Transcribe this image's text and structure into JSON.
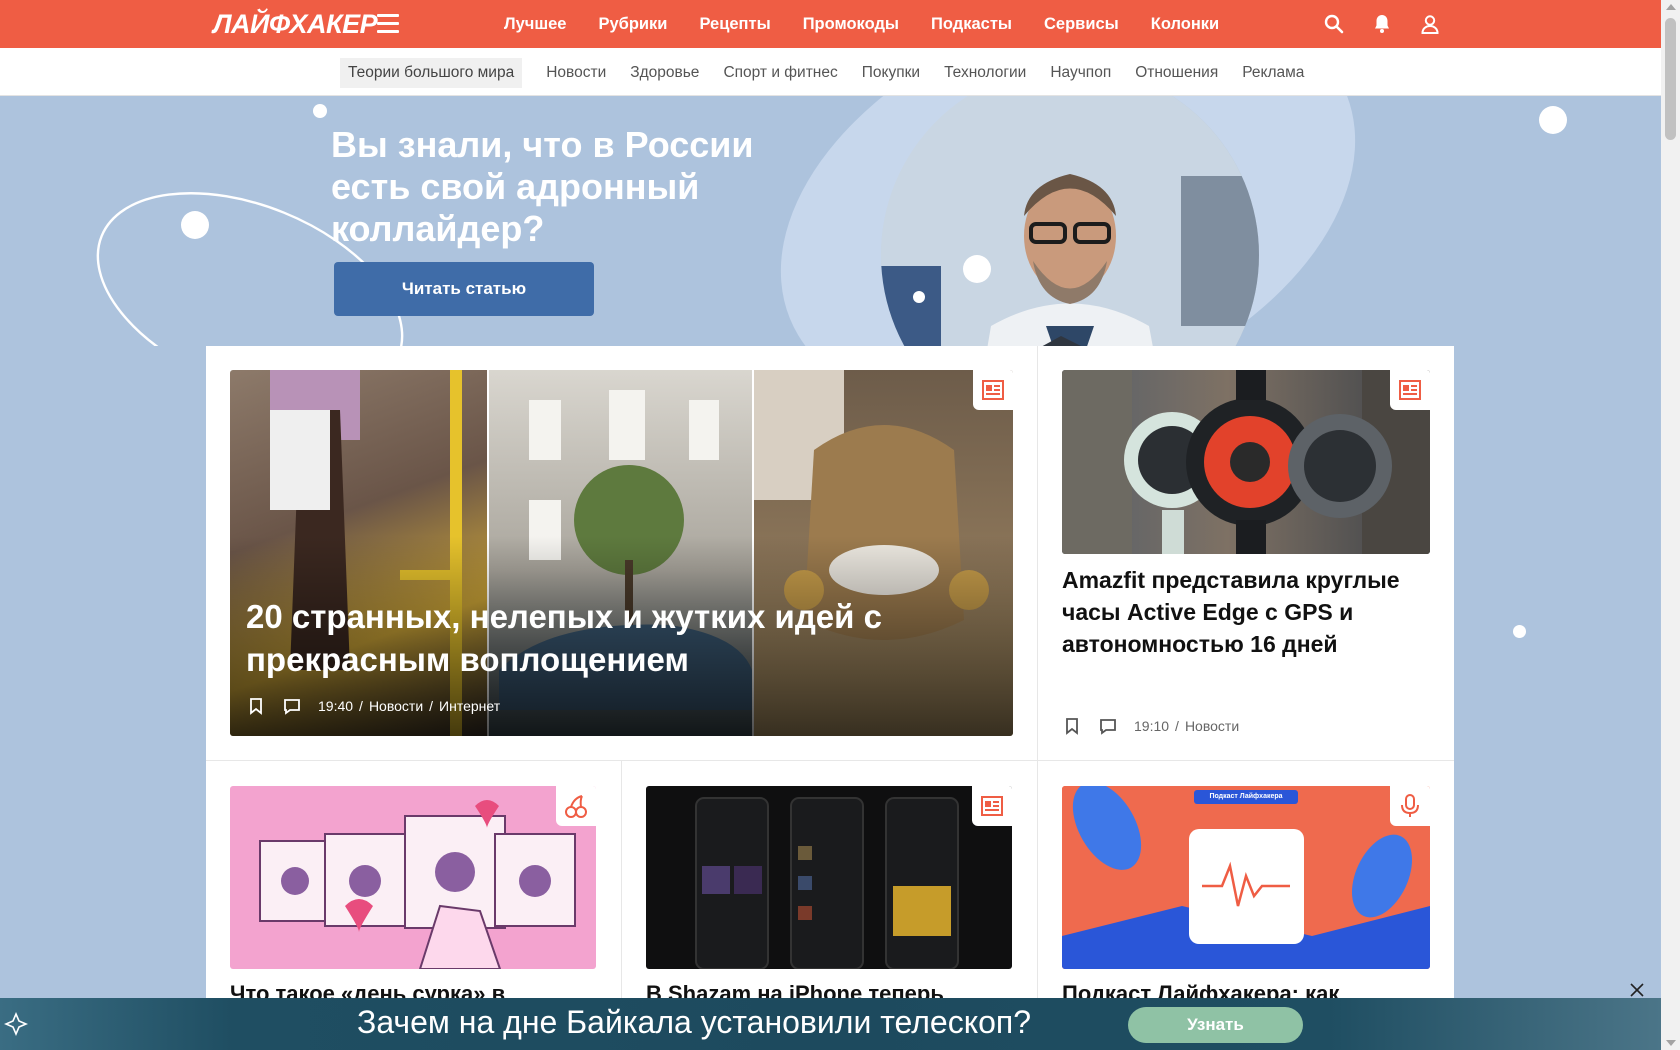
{
  "header": {
    "logo": "ЛАЙФХАКЕР",
    "nav": [
      "Лучшее",
      "Рубрики",
      "Рецепты",
      "Промокоды",
      "Подкасты",
      "Сервисы",
      "Колонки"
    ]
  },
  "subnav": {
    "items": [
      "Теории большого мира",
      "Новости",
      "Здоровье",
      "Спорт и фитнес",
      "Покупки",
      "Технологии",
      "Научпоп",
      "Отношения",
      "Реклама"
    ]
  },
  "hero": {
    "title": "Вы знали, что в России есть свой адронный коллайдер?",
    "button": "Читать статью"
  },
  "featured": {
    "title": "20 странных, нелепых и жутких идей с прекрасным воплощением",
    "time": "19:40",
    "category": "Новости",
    "tag": "Интернет"
  },
  "side_article": {
    "title": "Amazfit представила круглые часы Active Edge с GPS и автономностью 16 дней",
    "time": "19:10",
    "category": "Новости"
  },
  "row2": [
    {
      "title": "Что такое «день сурка» в"
    },
    {
      "title": "В Shazam на iPhone теперь"
    },
    {
      "title": "Подкаст Лайфхакера: как",
      "image_caption": "Подкаст Лайфхакера"
    }
  ],
  "banner": {
    "text": "Зачем на дне Байкала установили телескоп?",
    "button": "Узнать"
  },
  "colors": {
    "brand": "#ef5d44",
    "hero_bg": "#adc3dd",
    "hero_button": "#3f6ca8",
    "banner_button": "#8fc2a5"
  }
}
